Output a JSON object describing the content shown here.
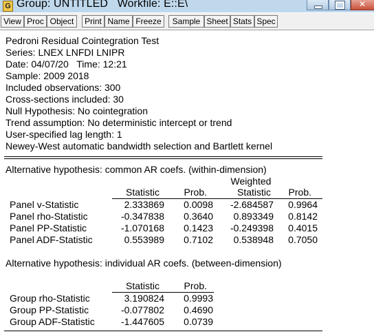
{
  "window": {
    "app_letter": "G",
    "title": "Group: UNTITLED   Workfile: E::E\\"
  },
  "toolbar": {
    "buttons": [
      "View",
      "Proc",
      "Object",
      "Print",
      "Name",
      "Freeze",
      "Sample",
      "Sheet",
      "Stats",
      "Spec"
    ]
  },
  "header_lines": [
    "Pedroni Residual Cointegration Test",
    "Series: LNEX LNFDI LNIPR",
    "Date: 04/07/20   Time: 12:21",
    "Sample: 2009 2018",
    "Included observations: 300",
    "Cross-sections included: 30",
    "Null Hypothesis: No cointegration",
    "Trend assumption: No deterministic intercept or trend",
    "User-specified lag length: 1",
    "Newey-West automatic bandwidth selection and Bartlett kernel"
  ],
  "within": {
    "title": "Alternative hypothesis: common AR coefs. (within-dimension)",
    "weighted_label": "Weighted",
    "columns": [
      "Statistic",
      "Prob.",
      "Statistic",
      "Prob."
    ],
    "rows": [
      {
        "name": "Panel v-Statistic",
        "stat": "2.333869",
        "prob": "0.0098",
        "wstat": "-2.684587",
        "wprob": "0.9964"
      },
      {
        "name": "Panel rho-Statistic",
        "stat": "-0.347838",
        "prob": "0.3640",
        "wstat": "0.893349",
        "wprob": "0.8142"
      },
      {
        "name": "Panel PP-Statistic",
        "stat": "-1.070168",
        "prob": "0.1423",
        "wstat": "-0.249398",
        "wprob": "0.4015"
      },
      {
        "name": "Panel ADF-Statistic",
        "stat": "0.553989",
        "prob": "0.7102",
        "wstat": "0.538948",
        "wprob": "0.7050"
      }
    ]
  },
  "between": {
    "title": "Alternative hypothesis: individual AR coefs. (between-dimension)",
    "columns": [
      "Statistic",
      "Prob."
    ],
    "rows": [
      {
        "name": "Group rho-Statistic",
        "stat": "3.190824",
        "prob": "0.9993"
      },
      {
        "name": "Group PP-Statistic",
        "stat": "-0.077802",
        "prob": "0.4690"
      },
      {
        "name": "Group ADF-Statistic",
        "stat": "-1.447605",
        "prob": "0.0739"
      }
    ]
  }
}
